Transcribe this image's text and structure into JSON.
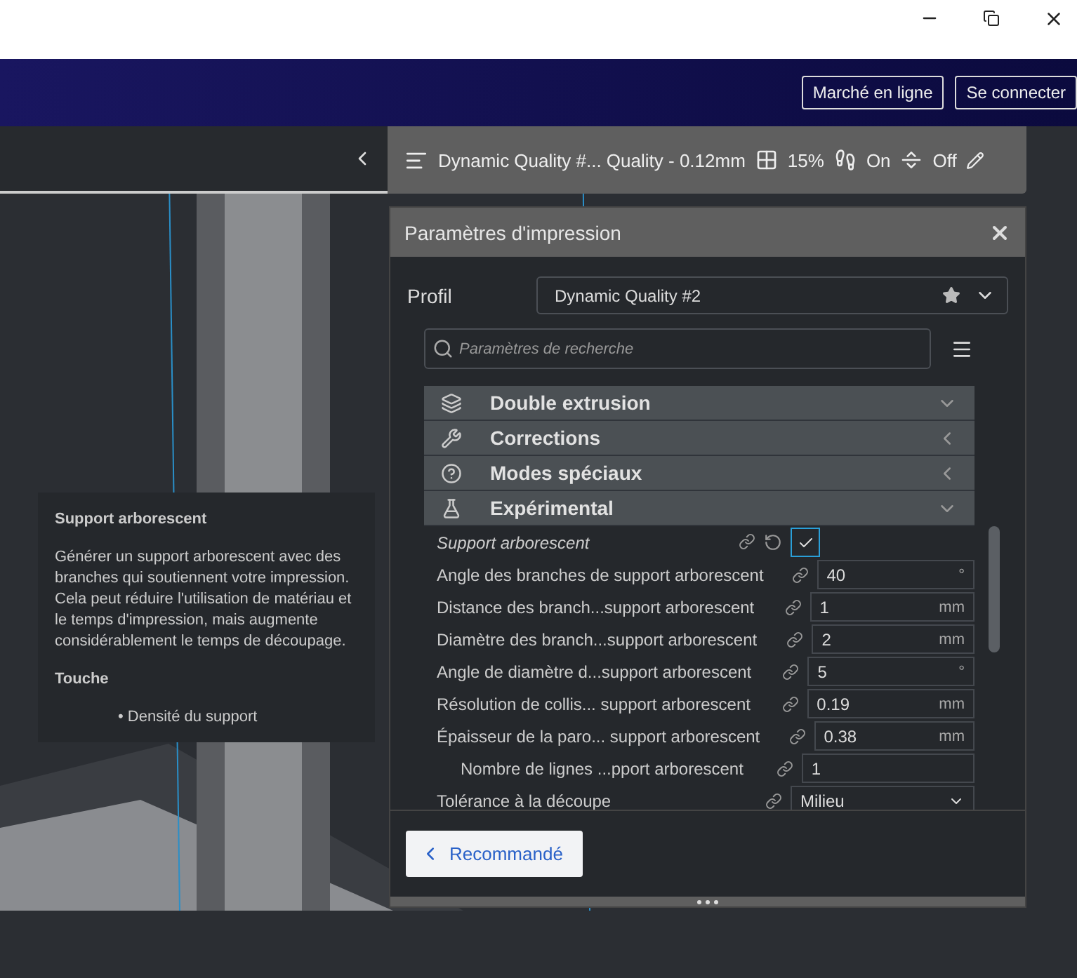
{
  "header": {
    "buttons": [
      "Marché en ligne",
      "Se connecter"
    ]
  },
  "print_bar": {
    "profile": "Dynamic Quality #... Quality - 0.12mm",
    "infill": "15%",
    "support": "On",
    "adhesion": "Off"
  },
  "panel": {
    "title": "Paramètres d'impression",
    "profile_label": "Profil",
    "profile_value": "Dynamic Quality #2",
    "search_placeholder": "Paramètres de recherche",
    "categories": [
      {
        "label": "Double extrusion",
        "expanded": true
      },
      {
        "label": "Corrections",
        "expanded": false
      },
      {
        "label": "Modes spéciaux",
        "expanded": false
      },
      {
        "label": "Expérimental",
        "expanded": true
      }
    ],
    "settings": [
      {
        "label": "Support arborescent",
        "kind": "checkbox",
        "checked": true,
        "overridden": true,
        "resettable": true
      },
      {
        "label": "Angle des branches de support arborescent",
        "kind": "number",
        "value": "40",
        "unit": "°",
        "overridden": false,
        "resettable": false
      },
      {
        "label": "Distance des branch...support arborescent",
        "kind": "number",
        "value": "1",
        "unit": "mm",
        "overridden": false,
        "resettable": false
      },
      {
        "label": "Diamètre des branch...support arborescent",
        "kind": "number",
        "value": "2",
        "unit": "mm",
        "overridden": false,
        "resettable": false
      },
      {
        "label": "Angle de diamètre d...support arborescent",
        "kind": "number",
        "value": "5",
        "unit": "°",
        "overridden": false,
        "resettable": false
      },
      {
        "label": "Résolution de collis... support arborescent",
        "kind": "number",
        "value": "0.19",
        "unit": "mm",
        "overridden": false,
        "resettable": false
      },
      {
        "label": "Épaisseur de la paro... support arborescent",
        "kind": "number",
        "value": "0.38",
        "unit": "mm",
        "overridden": false,
        "resettable": false,
        "children": [
          {
            "label": "Nombre de lignes ...pport arborescent",
            "kind": "number",
            "value": "1",
            "overridden": false,
            "resettable": false
          }
        ]
      },
      {
        "label": "Tolérance à la découpe",
        "kind": "dropdown",
        "value": "Milieu",
        "overridden": false,
        "resettable": false
      }
    ],
    "footer_button": "Recommandé"
  },
  "tooltip": {
    "title": "Support arborescent",
    "text": "Générer un support arborescent avec des branches qui soutiennent votre impression. Cela peut réduire l'utilisation de matériau et le temps d'impression, mais augmente considérablement le temps de découpage.",
    "section": "Touche",
    "items": [
      "• Densité du support"
    ]
  }
}
